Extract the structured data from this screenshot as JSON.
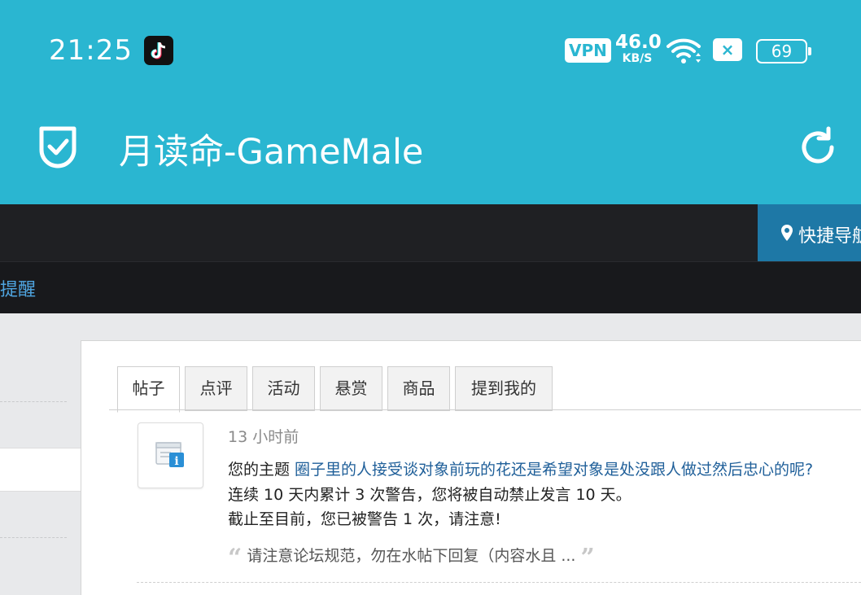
{
  "status_bar": {
    "time": "21:25",
    "vpn_label": "VPN",
    "speed_value": "46.0",
    "speed_unit": "KB/S",
    "sim_status": "×",
    "battery": "69"
  },
  "app_bar": {
    "title": "月读命-GameMale"
  },
  "nav": {
    "quick_nav_label": "快捷导航",
    "remind_label": "提醒"
  },
  "tabs": [
    {
      "label": "帖子",
      "active": true
    },
    {
      "label": "点评",
      "active": false
    },
    {
      "label": "活动",
      "active": false
    },
    {
      "label": "悬赏",
      "active": false
    },
    {
      "label": "商品",
      "active": false
    },
    {
      "label": "提到我的",
      "active": false
    }
  ],
  "notice": {
    "time": "13 小时前",
    "prefix": "您的主题 ",
    "topic_link": "圈子里的人接受谈对象前玩的花还是希望对象是处没跟人做过然后忠心的呢?",
    "line2": "连续 10 天内累计 3 次警告，您将被自动禁止发言 10 天。",
    "line3": "截止至目前，您已被警告 1 次，请注意!",
    "quote_text": "请注意论坛规范，勿在水帖下回复（内容水且 ...",
    "quote_open": "“",
    "quote_close": "”"
  },
  "colors": {
    "app_bar": "#2ab6d1",
    "dark_nav": "#1f2023",
    "quick_nav": "#1e78a6",
    "link": "#1f5f99"
  }
}
